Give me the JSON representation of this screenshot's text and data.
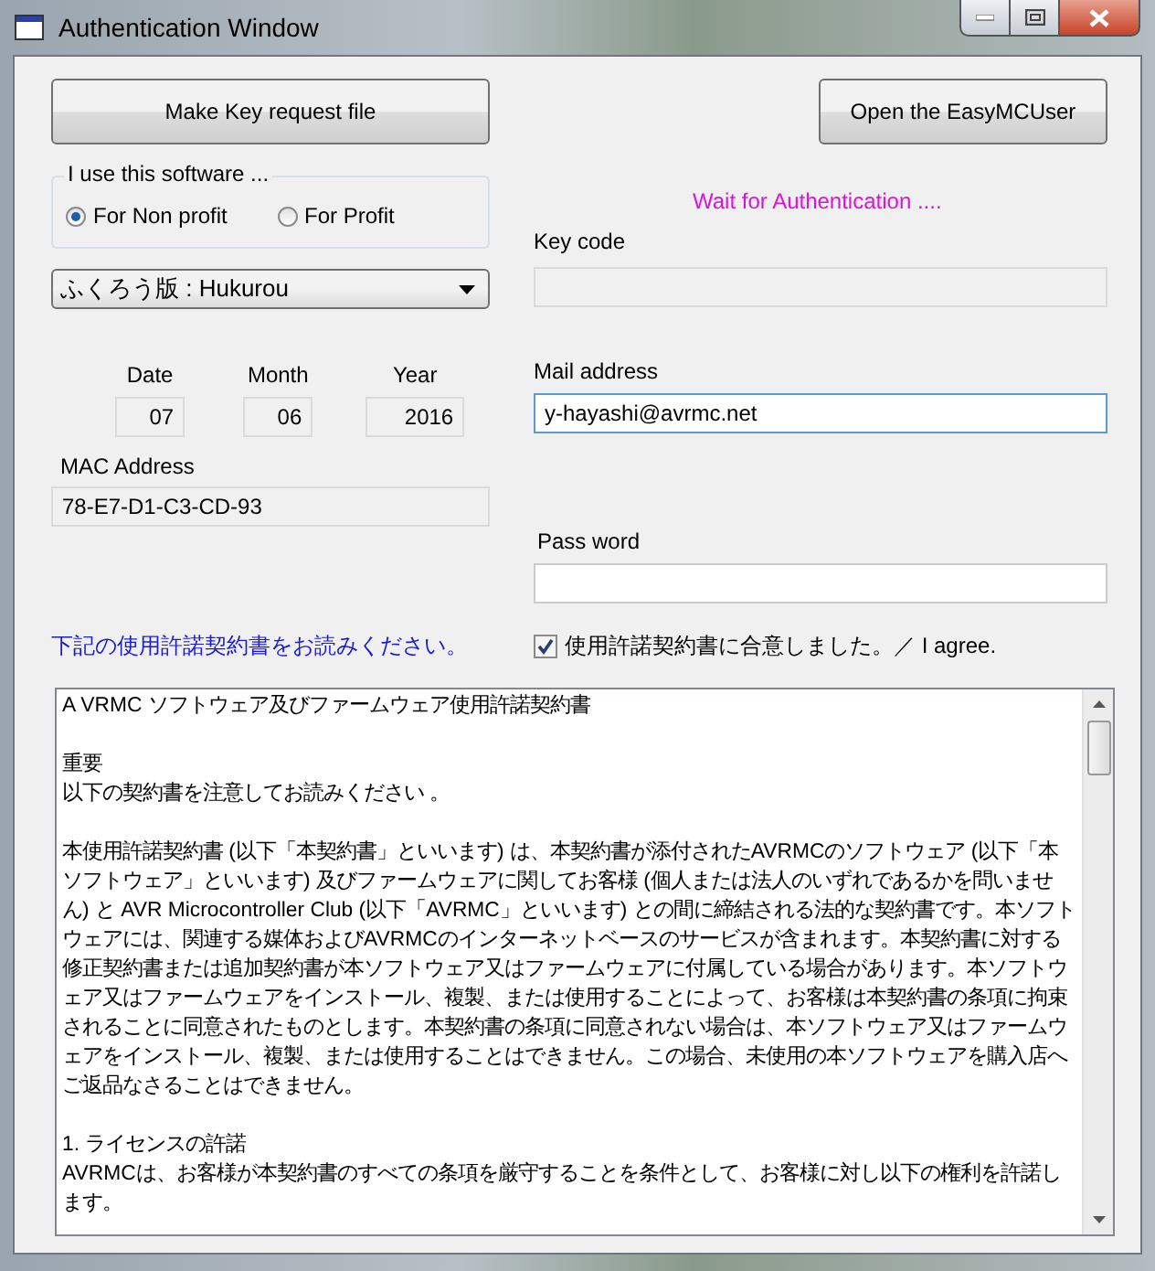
{
  "window": {
    "title": "Authentication Window"
  },
  "buttons": [
    {
      "kind": "make_key",
      "label": "Make Key request file"
    },
    {
      "kind": "open_user",
      "label": "Open the EasyMCUser"
    }
  ],
  "usage_group": {
    "label": "I use this software ...",
    "options": [
      {
        "label": "For Non profit",
        "selected": true
      },
      {
        "label": "For Profit",
        "selected": false
      }
    ]
  },
  "edition_select": {
    "value": "ふくろう版 : Hukurou"
  },
  "date_fields": [
    {
      "label": "Date",
      "value": "07",
      "disabled": true
    },
    {
      "label": "Month",
      "value": "06",
      "disabled": true
    },
    {
      "label": "Year",
      "value": "2016",
      "disabled": true
    }
  ],
  "mac_address": {
    "label": "MAC Address",
    "value": "78-E7-D1-C3-CD-93",
    "disabled": true
  },
  "status": "Wait for Authentication ....",
  "key_code": {
    "label": "Key code",
    "disabled": true
  },
  "mail_address": {
    "label": "Mail address",
    "value": "y-hayashi@avrmc.net",
    "disabled": false
  },
  "password": {
    "label": "Pass word",
    "disabled": false
  },
  "agreement": {
    "notice": "下記の使用許諾契約書をお読みください。",
    "agree": {
      "label": "使用許諾契約書に合意しました。／ I agree.",
      "checked": true
    },
    "paragraphs": [
      [
        "A  VRMC ソフトウェア及びファームウェア使用許諾契約書"
      ],
      [
        "重要",
        "以下の契約書を注意してお読みください 。"
      ],
      [
        "本使用許諾契約書 (以下「本契約書」といいます) は、本契約書が添付されたAVRMCのソフトウェア (以下「本ソフトウェア」といいます) 及びファームウェアに関してお客様 (個人または法人のいずれであるかを問いません) と AVR Microcontroller Club (以下「AVRMC」といいます) との間に締結される法的な契約書です。本ソフトウェアには、関連する媒体およびAVRMCのインターネットベースのサービスが含まれます。本契約書に対する修正契約書または追加契約書が本ソフトウェア又はファームウェアに付属している場合があります。本ソフトウェア又はファームウェアをインストール、複製、または使用することによって、お客様は本契約書の条項に拘束されることに同意されたものとします。本契約書の条項に同意されない場合は、本ソフトウェア又はファームウェアをインストール、複製、または使用することはできません。この場合、未使用の本ソフトウェアを購入店へご返品なさることはできません。"
      ],
      [
        "1. ライセンスの許諾",
        "AVRMCは、お客様が本契約書のすべての条項を厳守することを条件として、お客様に対し以下の権利を許諾します。"
      ]
    ]
  }
}
